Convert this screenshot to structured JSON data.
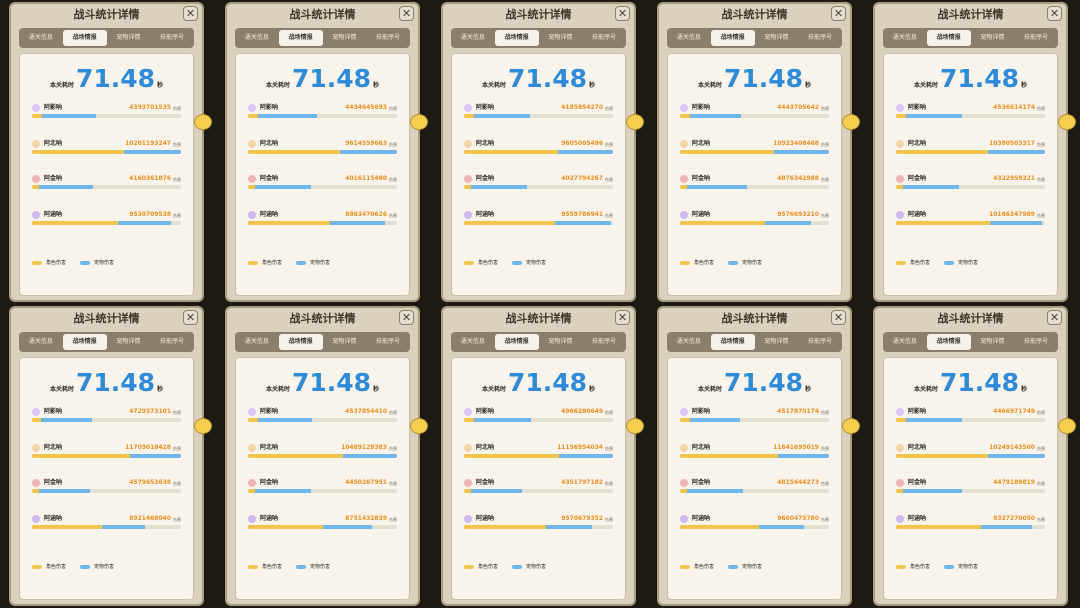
{
  "panel": {
    "title": "战斗统计详情",
    "tabs": [
      "通关信息",
      "战场情报",
      "宠物详情",
      "技能序号"
    ],
    "active_tab_index": 1,
    "close_icon": "close-icon"
  },
  "summary": {
    "time_label": "本关耗时",
    "time_value": "71.48",
    "time_unit": "秒"
  },
  "legend": {
    "character_damage": "角色伤害",
    "pet_damage": "宠物伤害"
  },
  "colors": {
    "character_bar": "#f3c44e",
    "pet_bar": "#6fb6ea",
    "time": "#2f8bd8",
    "damage_text": "#ef8f1f"
  },
  "unit_label": "伤害",
  "panels": [
    {
      "rows": [
        {
          "name": "阿影呐",
          "value": "4393701535",
          "char_frac": 0.07,
          "total_frac": 0.43
        },
        {
          "name": "阿北呐",
          "value": "10201193247",
          "char_frac": 0.62,
          "total_frac": 1.0
        },
        {
          "name": "阿金呐",
          "value": "4160361876",
          "char_frac": 0.05,
          "total_frac": 0.41
        },
        {
          "name": "阿涵呐",
          "value": "9530709538",
          "char_frac": 0.58,
          "total_frac": 0.93
        }
      ]
    },
    {
      "rows": [
        {
          "name": "阿影呐",
          "value": "4434645693",
          "char_frac": 0.07,
          "total_frac": 0.46
        },
        {
          "name": "阿北呐",
          "value": "9614559663",
          "char_frac": 0.62,
          "total_frac": 1.0
        },
        {
          "name": "阿金呐",
          "value": "4016115480",
          "char_frac": 0.05,
          "total_frac": 0.42
        },
        {
          "name": "阿涵呐",
          "value": "8863470626",
          "char_frac": 0.55,
          "total_frac": 0.92
        }
      ]
    },
    {
      "rows": [
        {
          "name": "阿影呐",
          "value": "4185854270",
          "char_frac": 0.07,
          "total_frac": 0.44
        },
        {
          "name": "阿北呐",
          "value": "9605005496",
          "char_frac": 0.63,
          "total_frac": 1.0
        },
        {
          "name": "阿金呐",
          "value": "4027794267",
          "char_frac": 0.05,
          "total_frac": 0.42
        },
        {
          "name": "阿涵呐",
          "value": "9559786941",
          "char_frac": 0.61,
          "total_frac": 0.99
        }
      ]
    },
    {
      "rows": [
        {
          "name": "阿影呐",
          "value": "4443705642",
          "char_frac": 0.07,
          "total_frac": 0.41
        },
        {
          "name": "阿北呐",
          "value": "10923408468",
          "char_frac": 0.63,
          "total_frac": 1.0
        },
        {
          "name": "阿金呐",
          "value": "4876342988",
          "char_frac": 0.05,
          "total_frac": 0.45
        },
        {
          "name": "阿涵呐",
          "value": "9576693210",
          "char_frac": 0.57,
          "total_frac": 0.88
        }
      ]
    },
    {
      "rows": [
        {
          "name": "阿影呐",
          "value": "4536614174",
          "char_frac": 0.07,
          "total_frac": 0.44
        },
        {
          "name": "阿北呐",
          "value": "10380503317",
          "char_frac": 0.62,
          "total_frac": 1.0
        },
        {
          "name": "阿金呐",
          "value": "4322959221",
          "char_frac": 0.05,
          "total_frac": 0.42
        },
        {
          "name": "阿涵呐",
          "value": "10166347989",
          "char_frac": 0.63,
          "total_frac": 0.98
        }
      ]
    },
    {
      "rows": [
        {
          "name": "阿影呐",
          "value": "4729373101",
          "char_frac": 0.06,
          "total_frac": 0.4
        },
        {
          "name": "阿北呐",
          "value": "11709018428",
          "char_frac": 0.66,
          "total_frac": 1.0
        },
        {
          "name": "阿金呐",
          "value": "4579653638",
          "char_frac": 0.05,
          "total_frac": 0.39
        },
        {
          "name": "阿涵呐",
          "value": "8921468040",
          "char_frac": 0.47,
          "total_frac": 0.76
        }
      ]
    },
    {
      "rows": [
        {
          "name": "阿影呐",
          "value": "4537854410",
          "char_frac": 0.07,
          "total_frac": 0.43
        },
        {
          "name": "阿北呐",
          "value": "10489129383",
          "char_frac": 0.64,
          "total_frac": 1.0
        },
        {
          "name": "阿金呐",
          "value": "4450267951",
          "char_frac": 0.05,
          "total_frac": 0.42
        },
        {
          "name": "阿涵呐",
          "value": "8751432839",
          "char_frac": 0.5,
          "total_frac": 0.83
        }
      ]
    },
    {
      "rows": [
        {
          "name": "阿影呐",
          "value": "4966280649",
          "char_frac": 0.07,
          "total_frac": 0.45
        },
        {
          "name": "阿北呐",
          "value": "11156954034",
          "char_frac": 0.64,
          "total_frac": 1.0
        },
        {
          "name": "阿金呐",
          "value": "4351797182",
          "char_frac": 0.05,
          "total_frac": 0.39
        },
        {
          "name": "阿涵呐",
          "value": "9570679352",
          "char_frac": 0.55,
          "total_frac": 0.86
        }
      ]
    },
    {
      "rows": [
        {
          "name": "阿影呐",
          "value": "4517870174",
          "char_frac": 0.07,
          "total_frac": 0.4
        },
        {
          "name": "阿北呐",
          "value": "11641695019",
          "char_frac": 0.66,
          "total_frac": 1.0
        },
        {
          "name": "阿金呐",
          "value": "4815644273",
          "char_frac": 0.05,
          "total_frac": 0.42
        },
        {
          "name": "阿涵呐",
          "value": "9660475780",
          "char_frac": 0.53,
          "total_frac": 0.83
        }
      ]
    },
    {
      "rows": [
        {
          "name": "阿影呐",
          "value": "4466971749",
          "char_frac": 0.07,
          "total_frac": 0.44
        },
        {
          "name": "阿北呐",
          "value": "10249143500",
          "char_frac": 0.62,
          "total_frac": 1.0
        },
        {
          "name": "阿金呐",
          "value": "4479189819",
          "char_frac": 0.05,
          "total_frac": 0.44
        },
        {
          "name": "阿涵呐",
          "value": "9327270050",
          "char_frac": 0.57,
          "total_frac": 0.91
        }
      ]
    }
  ]
}
